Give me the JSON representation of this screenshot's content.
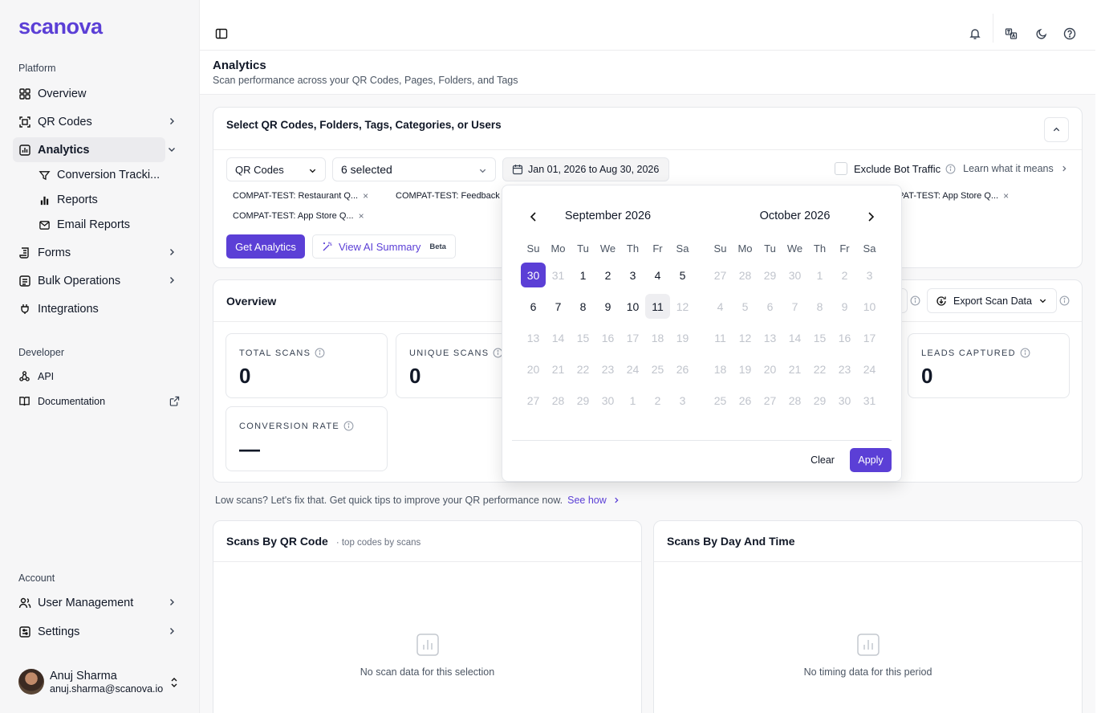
{
  "brand": {
    "logo_text": "scanova",
    "accent": "#5b3fd6"
  },
  "sidebar": {
    "platform_label": "Platform",
    "items": [
      {
        "label": "Overview",
        "icon": "grid-icon"
      },
      {
        "label": "QR Codes",
        "icon": "qr-scan-icon"
      },
      {
        "label": "Analytics",
        "icon": "bar-chart-icon"
      },
      {
        "label": "Forms",
        "icon": "scroll-icon"
      },
      {
        "label": "Bulk Operations",
        "icon": "stack-icon"
      },
      {
        "label": "Integrations",
        "icon": "plug-icon"
      }
    ],
    "analytics_sub": [
      {
        "label": "Conversion Tracki...",
        "icon": "funnel-icon"
      },
      {
        "label": "Reports",
        "icon": "bar-chart-small-icon"
      },
      {
        "label": "Email Reports",
        "icon": "mail-icon"
      }
    ],
    "developer_label": "Developer",
    "developer_items": [
      {
        "label": "API",
        "icon": "webhook-icon"
      },
      {
        "label": "Documentation",
        "icon": "book-icon"
      }
    ],
    "account_label": "Account",
    "account_items": [
      {
        "label": "User Management",
        "icon": "users-icon"
      },
      {
        "label": "Settings",
        "icon": "settings-icon"
      }
    ],
    "user": {
      "name": "Anuj Sharma",
      "email": "anuj.sharma@scanova.io"
    }
  },
  "header": {
    "title": "Analytics",
    "subtitle": "Scan performance across your QR Codes, Pages, Folders, and Tags"
  },
  "selector": {
    "title": "Select QR Codes, Folders, Tags, Categories, or Users",
    "type_value": "QR Codes",
    "items_value": "6 selected",
    "date_range": "Jan 01, 2026 to Aug 30, 2026",
    "exclude_bot_label": "Exclude Bot Traffic",
    "learn_label": "Learn what it means",
    "chips": [
      "COMPAT-TEST: Restaurant Q...",
      "COMPAT-TEST: Feedback",
      "MPAT-TEST: App Store Q...",
      "COMPAT-TEST: App Store Q..."
    ],
    "get_analytics_label": "Get Analytics",
    "ai_summary_label": "View AI Summary",
    "beta_label": "Beta"
  },
  "overview": {
    "title": "Overview",
    "export_label": "Export Scan Data",
    "stats": [
      {
        "label": "TOTAL SCANS",
        "value": "0"
      },
      {
        "label": "UNIQUE SCANS",
        "value": "0"
      },
      {
        "label": "LEADS CAPTURED",
        "value": "0"
      },
      {
        "label": "CONVERSION RATE",
        "value": "—"
      }
    ]
  },
  "tip": {
    "text": "Low scans? Let's fix that. Get quick tips to improve your QR performance now.",
    "link": "See how"
  },
  "scans_by_code": {
    "title": "Scans By QR Code",
    "subtitle": "· top codes by scans",
    "empty": "No scan data for this selection"
  },
  "scans_by_time": {
    "title": "Scans By Day And Time",
    "empty": "No timing data for this period"
  },
  "calendar": {
    "weekdays": [
      "Su",
      "Mo",
      "Tu",
      "We",
      "Th",
      "Fr",
      "Sa"
    ],
    "months": [
      {
        "title": "September 2026",
        "weeks": [
          [
            {
              "d": "30",
              "s": "sel"
            },
            {
              "d": "31",
              "s": "muted"
            },
            {
              "d": "1",
              "s": ""
            },
            {
              "d": "2",
              "s": ""
            },
            {
              "d": "3",
              "s": ""
            },
            {
              "d": "4",
              "s": ""
            },
            {
              "d": "5",
              "s": ""
            }
          ],
          [
            {
              "d": "6",
              "s": ""
            },
            {
              "d": "7",
              "s": ""
            },
            {
              "d": "8",
              "s": ""
            },
            {
              "d": "9",
              "s": ""
            },
            {
              "d": "10",
              "s": ""
            },
            {
              "d": "11",
              "s": "hov"
            },
            {
              "d": "12",
              "s": "muted"
            }
          ],
          [
            {
              "d": "13",
              "s": "muted"
            },
            {
              "d": "14",
              "s": "muted"
            },
            {
              "d": "15",
              "s": "muted"
            },
            {
              "d": "16",
              "s": "muted"
            },
            {
              "d": "17",
              "s": "muted"
            },
            {
              "d": "18",
              "s": "muted"
            },
            {
              "d": "19",
              "s": "muted"
            }
          ],
          [
            {
              "d": "20",
              "s": "muted"
            },
            {
              "d": "21",
              "s": "muted"
            },
            {
              "d": "22",
              "s": "muted"
            },
            {
              "d": "23",
              "s": "muted"
            },
            {
              "d": "24",
              "s": "muted"
            },
            {
              "d": "25",
              "s": "muted"
            },
            {
              "d": "26",
              "s": "muted"
            }
          ],
          [
            {
              "d": "27",
              "s": "muted"
            },
            {
              "d": "28",
              "s": "muted"
            },
            {
              "d": "29",
              "s": "muted"
            },
            {
              "d": "30",
              "s": "muted"
            },
            {
              "d": "1",
              "s": "muted"
            },
            {
              "d": "2",
              "s": "muted"
            },
            {
              "d": "3",
              "s": "muted"
            }
          ]
        ]
      },
      {
        "title": "October 2026",
        "weeks": [
          [
            {
              "d": "27",
              "s": "muted"
            },
            {
              "d": "28",
              "s": "muted"
            },
            {
              "d": "29",
              "s": "muted"
            },
            {
              "d": "30",
              "s": "muted"
            },
            {
              "d": "1",
              "s": "muted"
            },
            {
              "d": "2",
              "s": "muted"
            },
            {
              "d": "3",
              "s": "muted"
            }
          ],
          [
            {
              "d": "4",
              "s": "muted"
            },
            {
              "d": "5",
              "s": "muted"
            },
            {
              "d": "6",
              "s": "muted"
            },
            {
              "d": "7",
              "s": "muted"
            },
            {
              "d": "8",
              "s": "muted"
            },
            {
              "d": "9",
              "s": "muted"
            },
            {
              "d": "10",
              "s": "muted"
            }
          ],
          [
            {
              "d": "11",
              "s": "muted"
            },
            {
              "d": "12",
              "s": "muted"
            },
            {
              "d": "13",
              "s": "muted"
            },
            {
              "d": "14",
              "s": "muted"
            },
            {
              "d": "15",
              "s": "muted"
            },
            {
              "d": "16",
              "s": "muted"
            },
            {
              "d": "17",
              "s": "muted"
            }
          ],
          [
            {
              "d": "18",
              "s": "muted"
            },
            {
              "d": "19",
              "s": "muted"
            },
            {
              "d": "20",
              "s": "muted"
            },
            {
              "d": "21",
              "s": "muted"
            },
            {
              "d": "22",
              "s": "muted"
            },
            {
              "d": "23",
              "s": "muted"
            },
            {
              "d": "24",
              "s": "muted"
            }
          ],
          [
            {
              "d": "25",
              "s": "muted"
            },
            {
              "d": "26",
              "s": "muted"
            },
            {
              "d": "27",
              "s": "muted"
            },
            {
              "d": "28",
              "s": "muted"
            },
            {
              "d": "29",
              "s": "muted"
            },
            {
              "d": "30",
              "s": "muted"
            },
            {
              "d": "31",
              "s": "muted"
            }
          ]
        ]
      }
    ],
    "clear_label": "Clear",
    "apply_label": "Apply"
  }
}
